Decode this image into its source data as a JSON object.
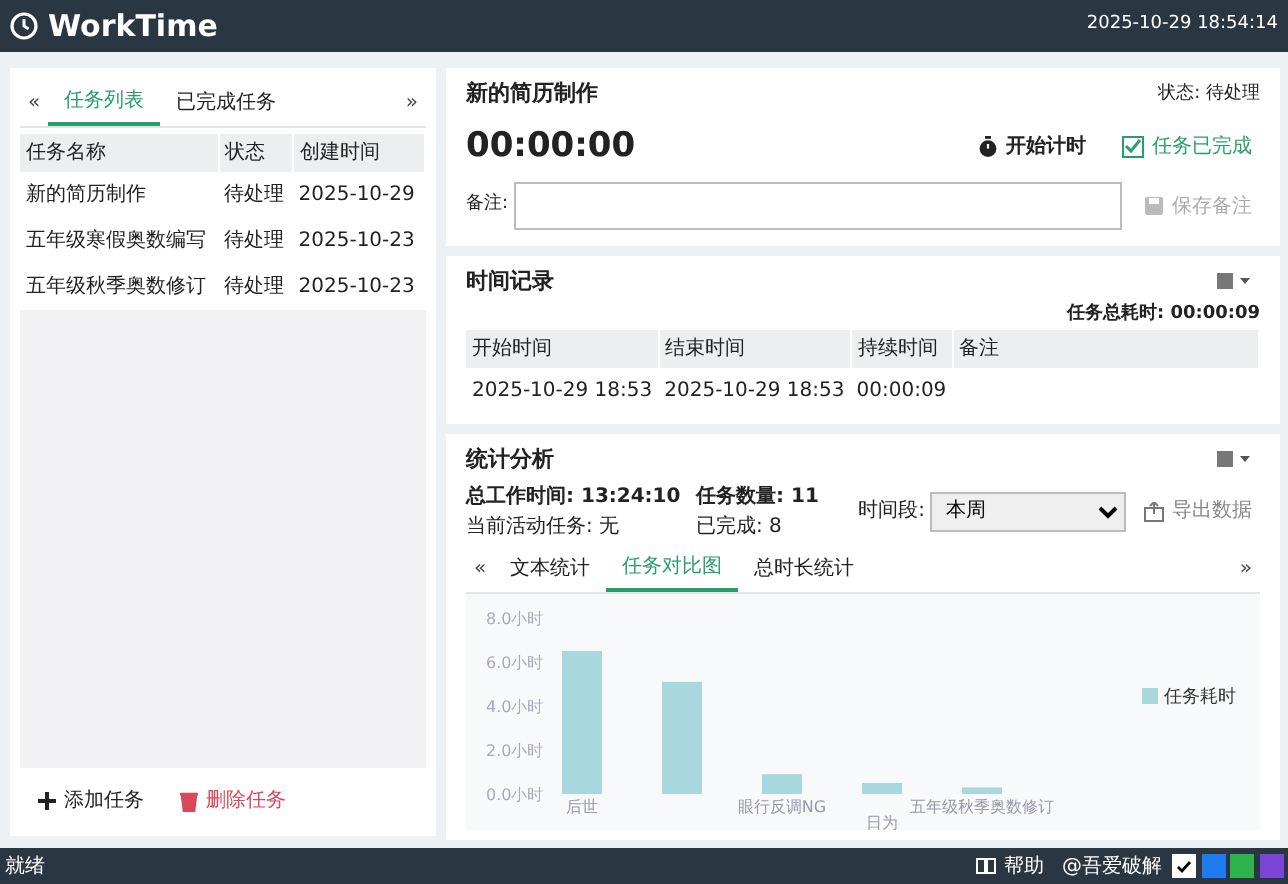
{
  "header": {
    "title": "WorkTime",
    "clock": "2025-10-29 18:54:14"
  },
  "task_panel": {
    "prev": "«",
    "next": "»",
    "tabs": [
      {
        "label": "任务列表",
        "selected": true
      },
      {
        "label": "已完成任务",
        "selected": false
      }
    ],
    "columns": [
      "任务名称",
      "状态",
      "创建时间"
    ],
    "rows": [
      {
        "cells": [
          "新的简历制作",
          "待处理",
          "2025-10-29"
        ],
        "selected": false
      },
      {
        "cells": [
          "五年级寒假奥数编写",
          "待处理",
          "2025-10-23"
        ],
        "selected": false
      },
      {
        "cells": [
          "五年级秋季奥数修订",
          "待处理",
          "2025-10-23"
        ],
        "selected": false
      }
    ],
    "add_button": "添加任务",
    "delete_button": "删除任务"
  },
  "task_detail": {
    "title": "新的简历制作",
    "status": "状态: 待处理",
    "timer": "00:00:00",
    "start_button": "开始计时",
    "completed": {
      "label": "任务已完成",
      "checked": true
    },
    "note_label": "备注:",
    "save_button": {
      "label": "保存备注",
      "disabled": true
    }
  },
  "time_records": {
    "title": "时间记录",
    "total": "任务总耗时: 00:00:09",
    "columns": [
      "开始时间",
      "结束时间",
      "持续时间",
      "备注"
    ],
    "rows": [
      [
        "2025-10-29 18:53",
        "2025-10-29 18:53",
        "00:00:09"
      ]
    ]
  },
  "statistics": {
    "title": "统计分析",
    "total_work": "总工作时间: 13:24:10",
    "active_task": "当前活动任务: 无",
    "task_count": "任务数量: 11",
    "completed": "已完成: 8",
    "period_label": "时间段:",
    "period_value": "本周",
    "export_button": "导出数据",
    "prev": "«",
    "next": "»",
    "tabs": [
      {
        "label": "文本统计",
        "selected": false
      },
      {
        "label": "任务对比图",
        "selected": true
      },
      {
        "label": "总时长统计",
        "selected": false
      }
    ],
    "chart_data": {
      "type": "bar",
      "categories": [
        "后世",
        null,
        "眼行反调NG",
        "日为",
        "五年级秋季奥数修订"
      ],
      "series": [
        {
          "name": "任务耗时",
          "color": "#a8d8de",
          "values": [
            6.5,
            5.1,
            0.9,
            0.5,
            0.3
          ]
        }
      ],
      "ylim": [
        0,
        8
      ],
      "yticks": [
        {
          "value": 0,
          "label": "0.0小时"
        },
        {
          "value": 2,
          "label": "2.0小时"
        },
        {
          "value": 4,
          "label": "4.0小时"
        },
        {
          "value": 6,
          "label": "6.0小时"
        },
        {
          "value": 8,
          "label": "8.0小时"
        }
      ]
    }
  },
  "status_bar": {
    "text": "就绪",
    "help": "帮助",
    "credit": "@吾爱破解",
    "themes": [
      {
        "color": "#ffffff",
        "selected": true
      },
      {
        "color": "#1e7bf0",
        "selected": false
      },
      {
        "color": "#2fb34a",
        "selected": false
      },
      {
        "color": "#7a45d6",
        "selected": false
      }
    ]
  }
}
